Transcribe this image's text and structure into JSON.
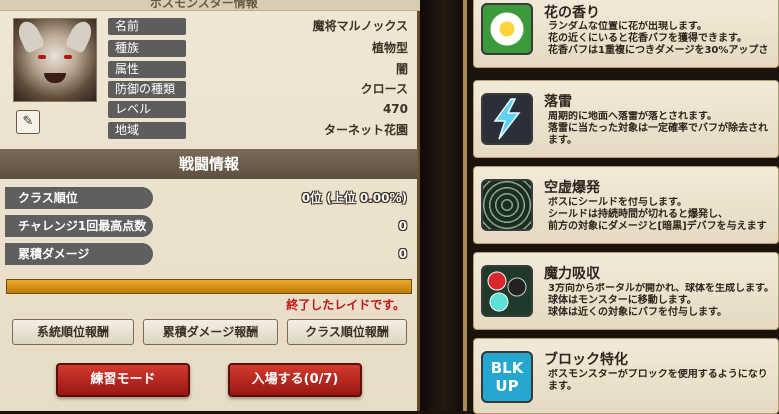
{
  "left": {
    "top_strip_text": "ボスモンスター情報",
    "boss": {
      "rows": [
        {
          "label": "名前",
          "value": "魔将マルノックス"
        },
        {
          "label": "種族",
          "value": "植物型"
        },
        {
          "label": "属性",
          "value": "闇"
        },
        {
          "label": "防御の種類",
          "value": "クロース"
        },
        {
          "label": "レベル",
          "value": "470"
        },
        {
          "label": "地域",
          "value": "ターネット花園"
        }
      ]
    },
    "battle_header": "戦闘情報",
    "stats": [
      {
        "label": "クラス順位",
        "value": "0位 (上位 0.00%)"
      },
      {
        "label": "チャレンジ1回最高点数",
        "value": "0"
      },
      {
        "label": "累積ダメージ",
        "value": "0"
      }
    ],
    "progress_value": 1.0,
    "raid_status": "終了したレイドです。",
    "reward_buttons": [
      "系統順位報酬",
      "累積ダメージ報酬",
      "クラス順位報酬"
    ],
    "practice_button": "練習モード",
    "enter_button": "入場する(0/7)"
  },
  "right": {
    "cards": [
      {
        "title": "花の香り",
        "icon": "flower-icon",
        "lines": [
          "ランダムな位置に花が出現します。",
          "花の近くにいると花香バフを獲得できます。",
          "花香バフは1重複につきダメージを30%アップさ"
        ]
      },
      {
        "title": "落雷",
        "icon": "lightning-icon",
        "lines": [
          "周期的に地面へ落雷が落とされます。",
          "落雷に当たった対象は一定確率でバフが除去され",
          "ます。"
        ]
      },
      {
        "title": "空虚爆発",
        "icon": "honeycomb-shield-icon",
        "lines": [
          "ボスにシールドを付与します。",
          "シールドは持続時間が切れると爆発し、",
          "前方の対象にダメージと[暗黒]デバフを与えます"
        ]
      },
      {
        "title": "魔力吸収",
        "icon": "orbs-icon",
        "lines": [
          "3方向からポータルが開かれ、球体を生成します。",
          "球体はモンスターに移動します。",
          "球体は近くの対象にバフを付与します。"
        ]
      },
      {
        "title": "ブロック特化",
        "icon": "block-up-icon",
        "icon_text_1": "BLK",
        "icon_text_2": "UP",
        "lines": [
          "ボスモンスターがブロックを使用するようになり",
          "ます。"
        ]
      }
    ]
  },
  "colors": {
    "label_bg": "#5d5d5d",
    "progress": "#c68a12",
    "raid_status": "#c01616",
    "red_button": "#b8261d"
  }
}
